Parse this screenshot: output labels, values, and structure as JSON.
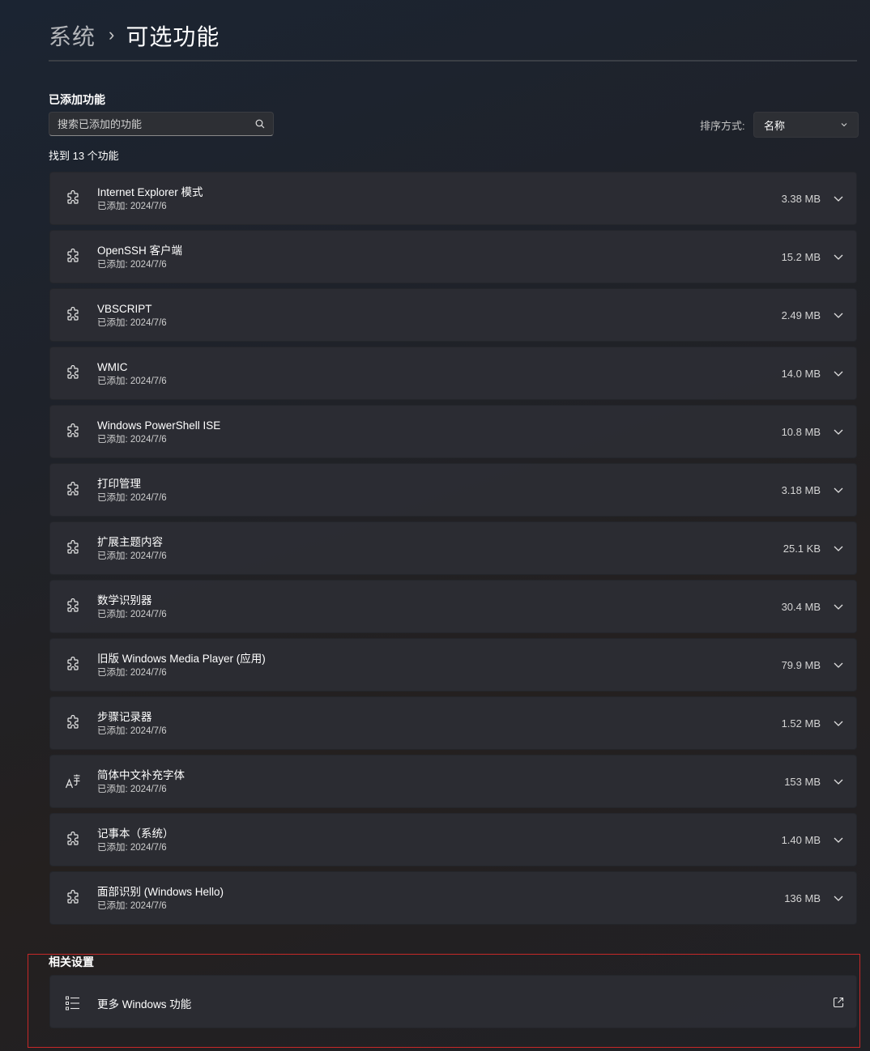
{
  "breadcrumb": {
    "parent": "系统",
    "separator": "›",
    "current": "可选功能"
  },
  "added_section": {
    "title": "已添加功能",
    "search_placeholder": "搜索已添加的功能",
    "sort_label": "排序方式:",
    "sort_value": "名称",
    "result_count": "找到 13 个功能"
  },
  "features": [
    {
      "name": "Internet Explorer 模式",
      "date": "已添加: 2024/7/6",
      "size": "3.38 MB",
      "icon": "puzzle-gear-icon"
    },
    {
      "name": "OpenSSH 客户端",
      "date": "已添加: 2024/7/6",
      "size": "15.2 MB",
      "icon": "puzzle-gear-icon"
    },
    {
      "name": "VBSCRIPT",
      "date": "已添加: 2024/7/6",
      "size": "2.49 MB",
      "icon": "puzzle-gear-icon"
    },
    {
      "name": "WMIC",
      "date": "已添加: 2024/7/6",
      "size": "14.0 MB",
      "icon": "puzzle-gear-icon"
    },
    {
      "name": "Windows PowerShell ISE",
      "date": "已添加: 2024/7/6",
      "size": "10.8 MB",
      "icon": "puzzle-gear-icon"
    },
    {
      "name": "打印管理",
      "date": "已添加: 2024/7/6",
      "size": "3.18 MB",
      "icon": "puzzle-gear-icon"
    },
    {
      "name": "扩展主题内容",
      "date": "已添加: 2024/7/6",
      "size": "25.1 KB",
      "icon": "puzzle-gear-icon"
    },
    {
      "name": "数学识别器",
      "date": "已添加: 2024/7/6",
      "size": "30.4 MB",
      "icon": "puzzle-gear-icon"
    },
    {
      "name": "旧版 Windows Media Player (应用)",
      "date": "已添加: 2024/7/6",
      "size": "79.9 MB",
      "icon": "puzzle-gear-icon"
    },
    {
      "name": "步骤记录器",
      "date": "已添加: 2024/7/6",
      "size": "1.52 MB",
      "icon": "puzzle-gear-icon"
    },
    {
      "name": "简体中文补充字体",
      "date": "已添加: 2024/7/6",
      "size": "153 MB",
      "icon": "font-icon"
    },
    {
      "name": "记事本（系统）",
      "date": "已添加: 2024/7/6",
      "size": "1.40 MB",
      "icon": "puzzle-gear-icon"
    },
    {
      "name": "面部识别 (Windows Hello)",
      "date": "已添加: 2024/7/6",
      "size": "136 MB",
      "icon": "puzzle-gear-icon"
    }
  ],
  "related_section": {
    "title": "相关设置",
    "items": [
      {
        "label": "更多 Windows 功能",
        "icon": "list-icon",
        "action_icon": "open-external-icon"
      }
    ]
  },
  "colors": {
    "highlight_frame": "#c62828",
    "card_background": "#2c2e34",
    "text_primary": "#ffffff",
    "text_secondary": "#cfcfcf"
  }
}
